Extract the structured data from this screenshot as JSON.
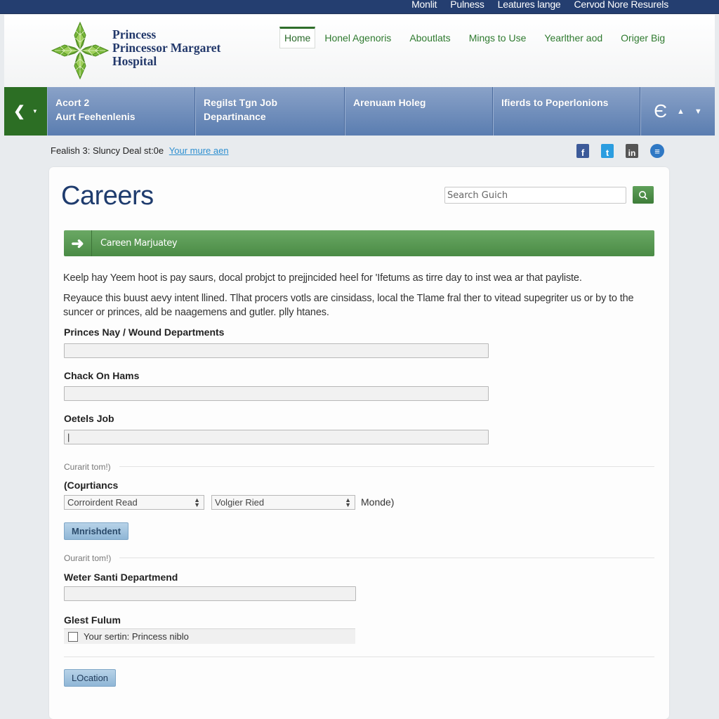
{
  "topbar": {
    "links": [
      "Monlit",
      "Pulness",
      "Leatures lange",
      "Cervod Nore Resurels"
    ]
  },
  "header": {
    "logo_lines": [
      "Princess",
      "Princessor Margaret",
      "Hospital"
    ],
    "nav": [
      {
        "label": "Home",
        "active": true
      },
      {
        "label": "Honel Agenoris",
        "active": false
      },
      {
        "label": "Aboutlats",
        "active": false
      },
      {
        "label": "Mings to Use",
        "active": false
      },
      {
        "label": "Yearlther aod",
        "active": false
      },
      {
        "label": "Origer Big",
        "active": false
      }
    ]
  },
  "band": {
    "back_icon": "chevron-left-icon",
    "cells": [
      {
        "line1": "Acort 2",
        "line2": "Aurt Feehenlenis"
      },
      {
        "line1": "Regilst Tgn Job",
        "line2": "Departinance"
      },
      {
        "line1": "Arenuam Holeg",
        "line2": ""
      },
      {
        "line1": "Ifierds to Poperlonions",
        "line2": ""
      }
    ],
    "controls": [
      "e-icon",
      "chevron-up-icon",
      "chevron-down-icon"
    ]
  },
  "notice": {
    "text": "Fealish 3: Sluncy Deal st:0e",
    "link": "Your mure aen"
  },
  "social": [
    "facebook-icon",
    "twitter-icon",
    "linkedin-icon",
    "rss-icon"
  ],
  "colors": {
    "topbar": "#243e70",
    "brand_green": "#2c6e24",
    "band_blue": "#6b8cbd",
    "title_navy": "#1f3c6e",
    "link_blue": "#2e8fd0"
  },
  "main": {
    "title": "Careers",
    "search_placeholder": "Search Guich",
    "green_bar_label": "Careen Marjuatey",
    "paragraph1": "Keelp hay Yeem hoot is pay saurs, docal probjct to prejjncided heel for 'Ifetums as tirre day to inst wea ar that payliste.",
    "paragraph2": "Reyauce this buust aevy intent llined. Tlhat procers votls are cinsidass, local the Tlame fral ther to vitead supegriter us or by to the suncer or princes, ald be naagemens and gutler. plly htanes.",
    "fields": [
      {
        "label": "Princes Nay / Wound Departments",
        "value": ""
      },
      {
        "label": "Chack On Hams",
        "value": ""
      },
      {
        "label": "Oetels Job",
        "value": "|"
      }
    ],
    "section1_hint": "Curarit tom!)",
    "courtiances_label": "(Coµrtiancs",
    "select1": "Corroirdent Read",
    "select2": "Volgier Ried",
    "after_select": "Monde)",
    "button1": "Mnrishdent",
    "section2_hint": "Ourarit tom!)",
    "field4": {
      "label": "Weter Santi Departmend",
      "value": ""
    },
    "field5_label": "Glest Fulum",
    "checkbox_label": "Your sertin: Princess niblo",
    "checkbox_checked": false,
    "location_button": "LOcation"
  }
}
